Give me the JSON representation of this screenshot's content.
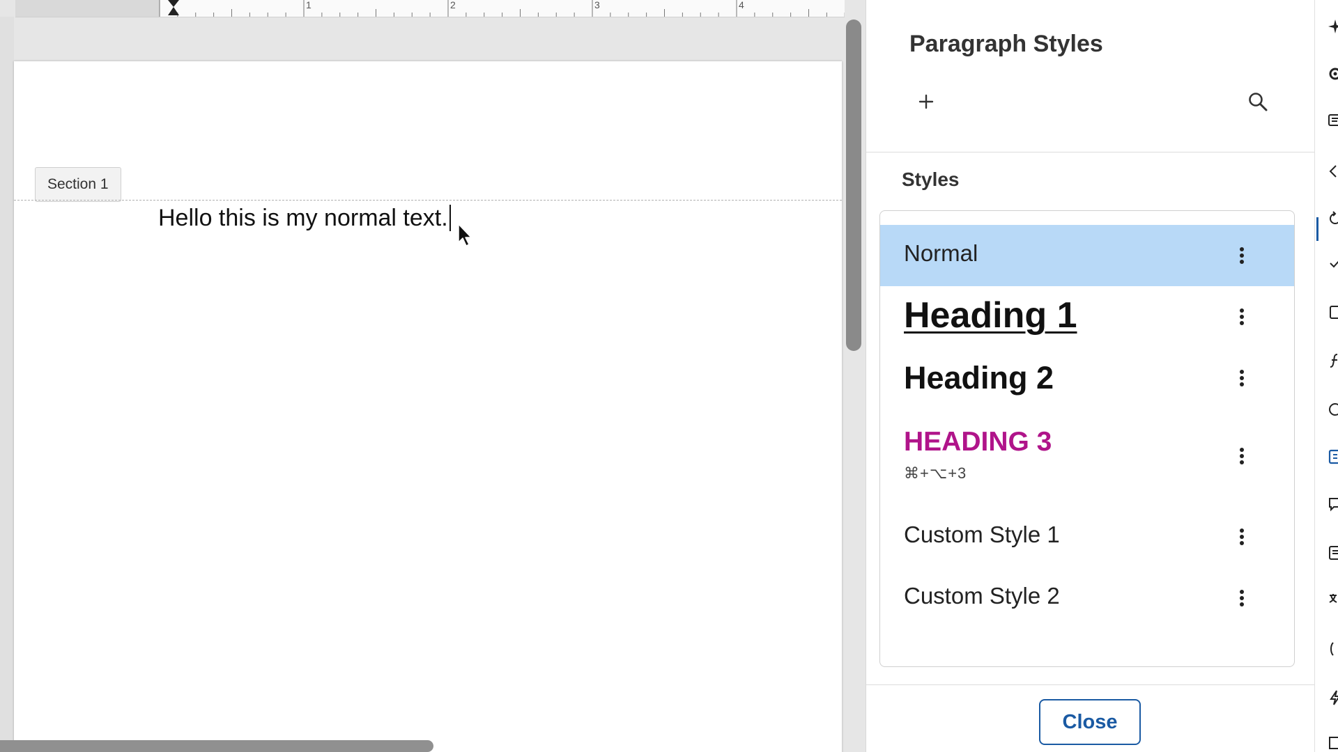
{
  "document": {
    "ruler_numbers": [
      "1",
      "2",
      "3",
      "4"
    ],
    "section_label": "Section 1",
    "body_text": "Hello this is my normal text."
  },
  "panel": {
    "title": "Paragraph Styles",
    "styles_heading": "Styles",
    "styles": [
      {
        "name": "Normal",
        "selected": true
      },
      {
        "name": "Heading 1"
      },
      {
        "name": "Heading 2"
      },
      {
        "name": "HEADING 3",
        "shortcut": "⌘+⌥+3",
        "color": "#b0148a"
      },
      {
        "name": "Custom Style 1"
      },
      {
        "name": "Custom Style 2"
      }
    ],
    "close_label": "Close"
  },
  "colors": {
    "accent": "#1a5aa3",
    "selected_row": "#b8d9f7",
    "heading3": "#b0148a"
  },
  "icons": {
    "add": "plus-icon",
    "search": "search-icon",
    "row_menu": "more-vertical-icon"
  }
}
